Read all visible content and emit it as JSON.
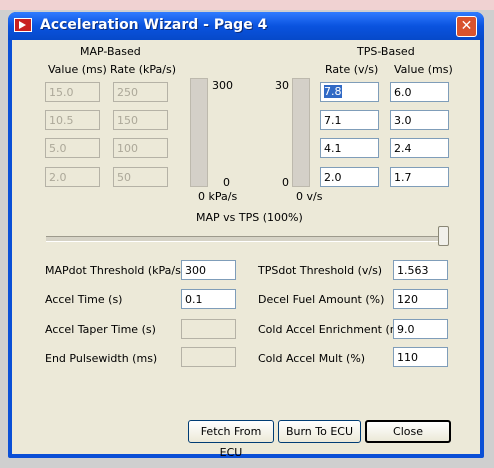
{
  "window": {
    "title": "Acceleration Wizard - Page 4"
  },
  "map": {
    "header": "MAP-Based",
    "col_value": "Value (ms)",
    "col_rate": "Rate (kPa/s)",
    "rows": [
      {
        "value": "15.0",
        "rate": "250"
      },
      {
        "value": "10.5",
        "rate": "150"
      },
      {
        "value": "5.0",
        "rate": "100"
      },
      {
        "value": "2.0",
        "rate": "50"
      }
    ],
    "bar_max": "300",
    "bar_min": "0",
    "bar_unit": "0 kPa/s"
  },
  "tps": {
    "header": "TPS-Based",
    "col_rate": "Rate (v/s)",
    "col_value": "Value (ms)",
    "rows": [
      {
        "rate": "7.8",
        "value": "6.0"
      },
      {
        "rate": "7.1",
        "value": "3.0"
      },
      {
        "rate": "4.1",
        "value": "2.4"
      },
      {
        "rate": "2.0",
        "value": "1.7"
      }
    ],
    "bar_max": "30",
    "bar_min": "0",
    "bar_unit": "0 v/s"
  },
  "slider": {
    "label": "MAP vs TPS (100%)",
    "level": 1.0
  },
  "settings_left": [
    {
      "label": "MAPdot Threshold (kPa/s)",
      "value": "300"
    },
    {
      "label": "Accel Time (s)",
      "value": "0.1"
    },
    {
      "label": "Accel Taper Time (s)",
      "value": ""
    },
    {
      "label": "End Pulsewidth (ms)",
      "value": ""
    }
  ],
  "settings_right": [
    {
      "label": "TPSdot Threshold (v/s)",
      "value": "1.563"
    },
    {
      "label": "Decel Fuel Amount (%)",
      "value": "120"
    },
    {
      "label": "Cold Accel Enrichment (ms)",
      "value": "9.0"
    },
    {
      "label": "Cold Accel Mult (%)",
      "value": "110"
    }
  ],
  "buttons": {
    "fetch": "Fetch From ECU",
    "burn": "Burn To ECU",
    "close": "Close"
  }
}
